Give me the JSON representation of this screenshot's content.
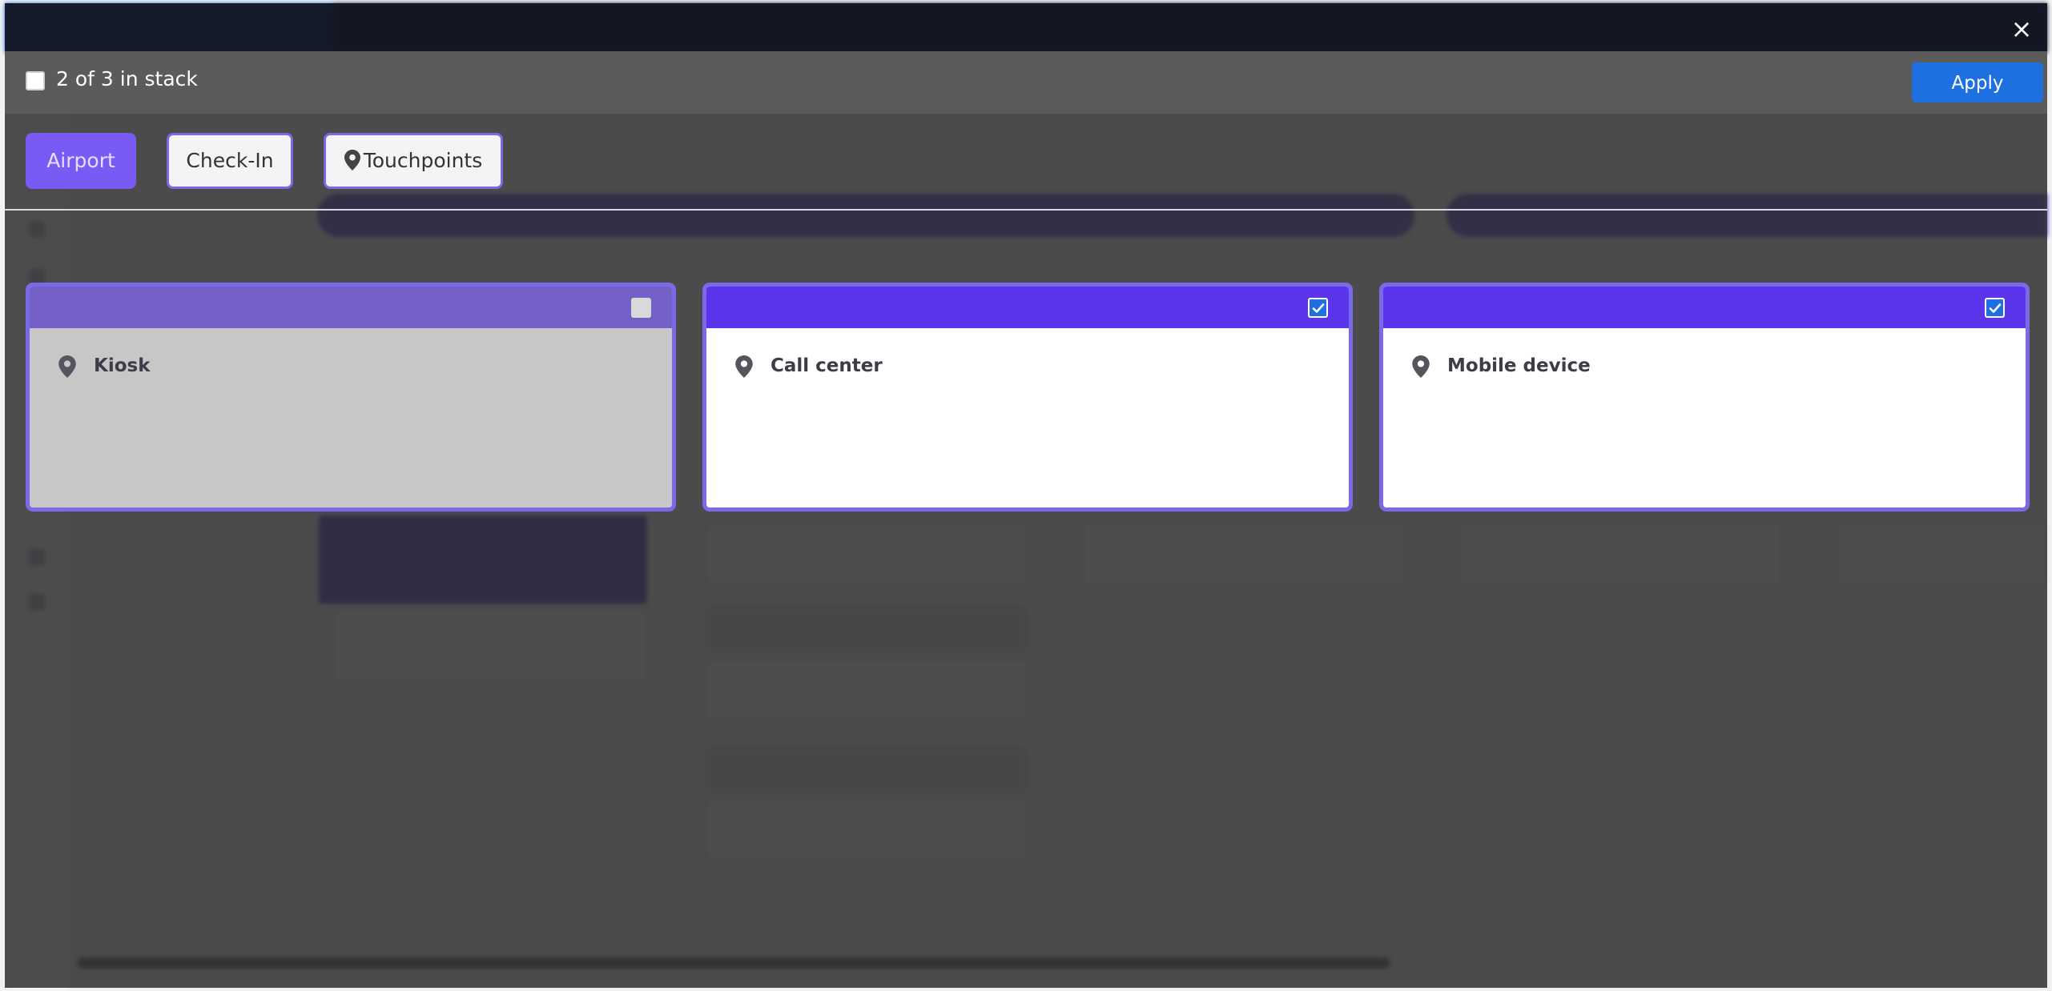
{
  "stack": {
    "label": "2 of 3 in stack",
    "apply_label": "Apply",
    "close_icon": "×"
  },
  "chips": [
    {
      "label": "Airport",
      "active": true
    },
    {
      "label": "Check-In",
      "active": false
    },
    {
      "label": "Touchpoints",
      "icon": "map-pin-icon",
      "active": false
    }
  ],
  "cards": [
    {
      "label": "Kiosk",
      "icon": "map-pin-icon",
      "checked": false
    },
    {
      "label": "Call center",
      "icon": "map-pin-icon",
      "checked": true
    },
    {
      "label": "Mobile device",
      "icon": "map-pin-icon",
      "checked": true
    }
  ],
  "colors": {
    "header_purple": "#5b35ec",
    "chip_active": "#7a5af5",
    "apply_blue": "#1e6fe0",
    "card_border": "#7b6ae8"
  }
}
